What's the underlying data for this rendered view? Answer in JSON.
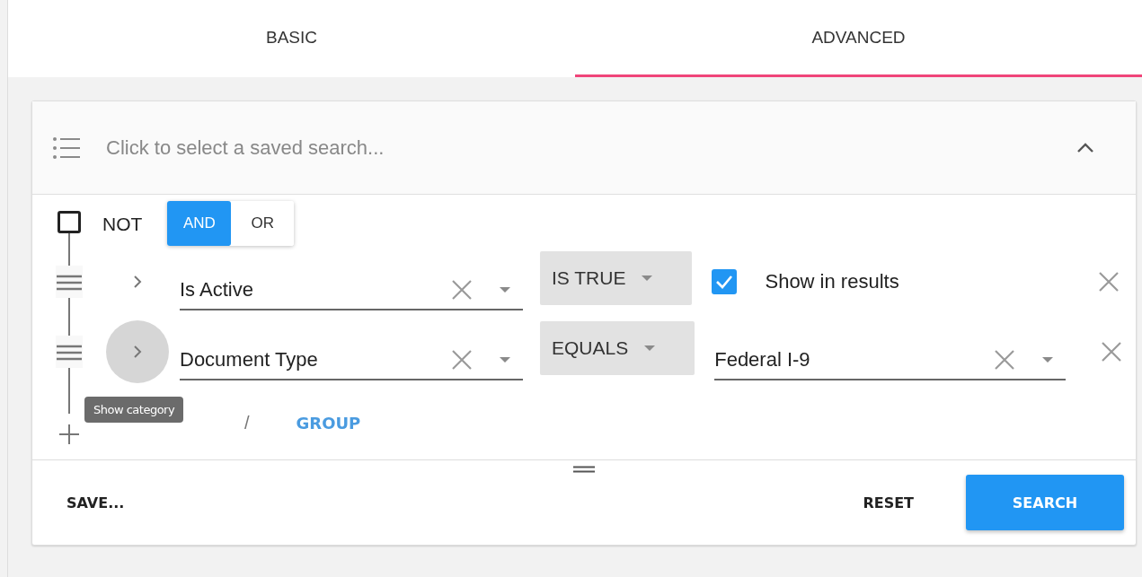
{
  "tabs": [
    {
      "label": "BASIC",
      "selected": false
    },
    {
      "label": "ADVANCED",
      "selected": true
    }
  ],
  "saved_search": {
    "placeholder": "Click to select a saved search...",
    "expanded": true
  },
  "group": {
    "not_label": "NOT",
    "not_checked": false,
    "combinators": [
      {
        "label": "AND",
        "selected": true
      },
      {
        "label": "OR",
        "selected": false
      }
    ]
  },
  "rules": [
    {
      "field": "Is Active",
      "chevron_hovered": false,
      "operator": "IS TRUE",
      "value": {
        "kind": "checkbox",
        "label": "Show in results",
        "checked": true
      }
    },
    {
      "field": "Document Type",
      "chevron_hovered": true,
      "tooltip": "Show category",
      "operator": "EQUALS",
      "value": {
        "kind": "select",
        "text": "Federal I-9"
      }
    }
  ],
  "add": {
    "separator": "/",
    "group": "GROUP"
  },
  "footer": {
    "save": "SAVE...",
    "reset": "RESET",
    "search": "SEARCH"
  }
}
